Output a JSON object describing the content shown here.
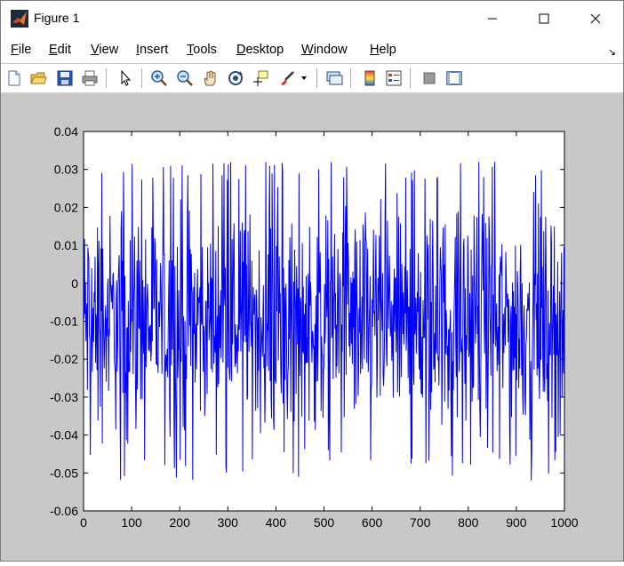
{
  "window": {
    "title": "Figure 1",
    "controls": [
      "minimize-button",
      "maximize-button",
      "close-button"
    ]
  },
  "menu": [
    {
      "label": "File",
      "key": "F"
    },
    {
      "label": "Edit",
      "key": "E"
    },
    {
      "label": "View",
      "key": "V"
    },
    {
      "label": "Insert",
      "key": "I"
    },
    {
      "label": "Tools",
      "key": "T"
    },
    {
      "label": "Desktop",
      "key": "D"
    },
    {
      "label": "Window",
      "key": "W"
    },
    {
      "label": "Help",
      "key": "H"
    }
  ],
  "toolbar": {
    "buttons": [
      {
        "icon": "new-figure-icon"
      },
      {
        "icon": "open-file-icon"
      },
      {
        "icon": "save-icon"
      },
      {
        "icon": "print-icon"
      },
      {
        "icon": "edit-plot-arrow-icon"
      },
      {
        "icon": "zoom-in-icon"
      },
      {
        "icon": "zoom-out-icon"
      },
      {
        "icon": "pan-hand-icon"
      },
      {
        "icon": "rotate-3d-icon"
      },
      {
        "icon": "data-cursor-icon"
      },
      {
        "icon": "brush-icon"
      },
      {
        "icon": "link-plot-icon"
      },
      {
        "icon": "insert-colorbar-icon"
      },
      {
        "icon": "insert-legend-icon"
      },
      {
        "icon": "hide-plot-tools-icon"
      },
      {
        "icon": "show-plot-tools-icon"
      }
    ]
  },
  "colors": {
    "line": "#0000ff",
    "figure_bg": "#c8c8c8",
    "axes_bg": "#ffffff"
  },
  "chart_data": {
    "type": "line",
    "title": "",
    "xlabel": "",
    "ylabel": "",
    "xlim": [
      0,
      1000
    ],
    "ylim": [
      -0.06,
      0.04
    ],
    "xticks": [
      "0",
      "100",
      "200",
      "300",
      "400",
      "500",
      "600",
      "700",
      "800",
      "900",
      "1000"
    ],
    "yticks": [
      "0.04",
      "0.03",
      "0.02",
      "0.01",
      "0",
      "-0.01",
      "-0.02",
      "-0.03",
      "-0.04",
      "-0.05",
      "-0.06"
    ],
    "grid": false,
    "series": [
      {
        "color": "#0000ff",
        "n_points": 1000,
        "x_step": 1,
        "y_range": [
          -0.052,
          0.032
        ]
      }
    ]
  }
}
